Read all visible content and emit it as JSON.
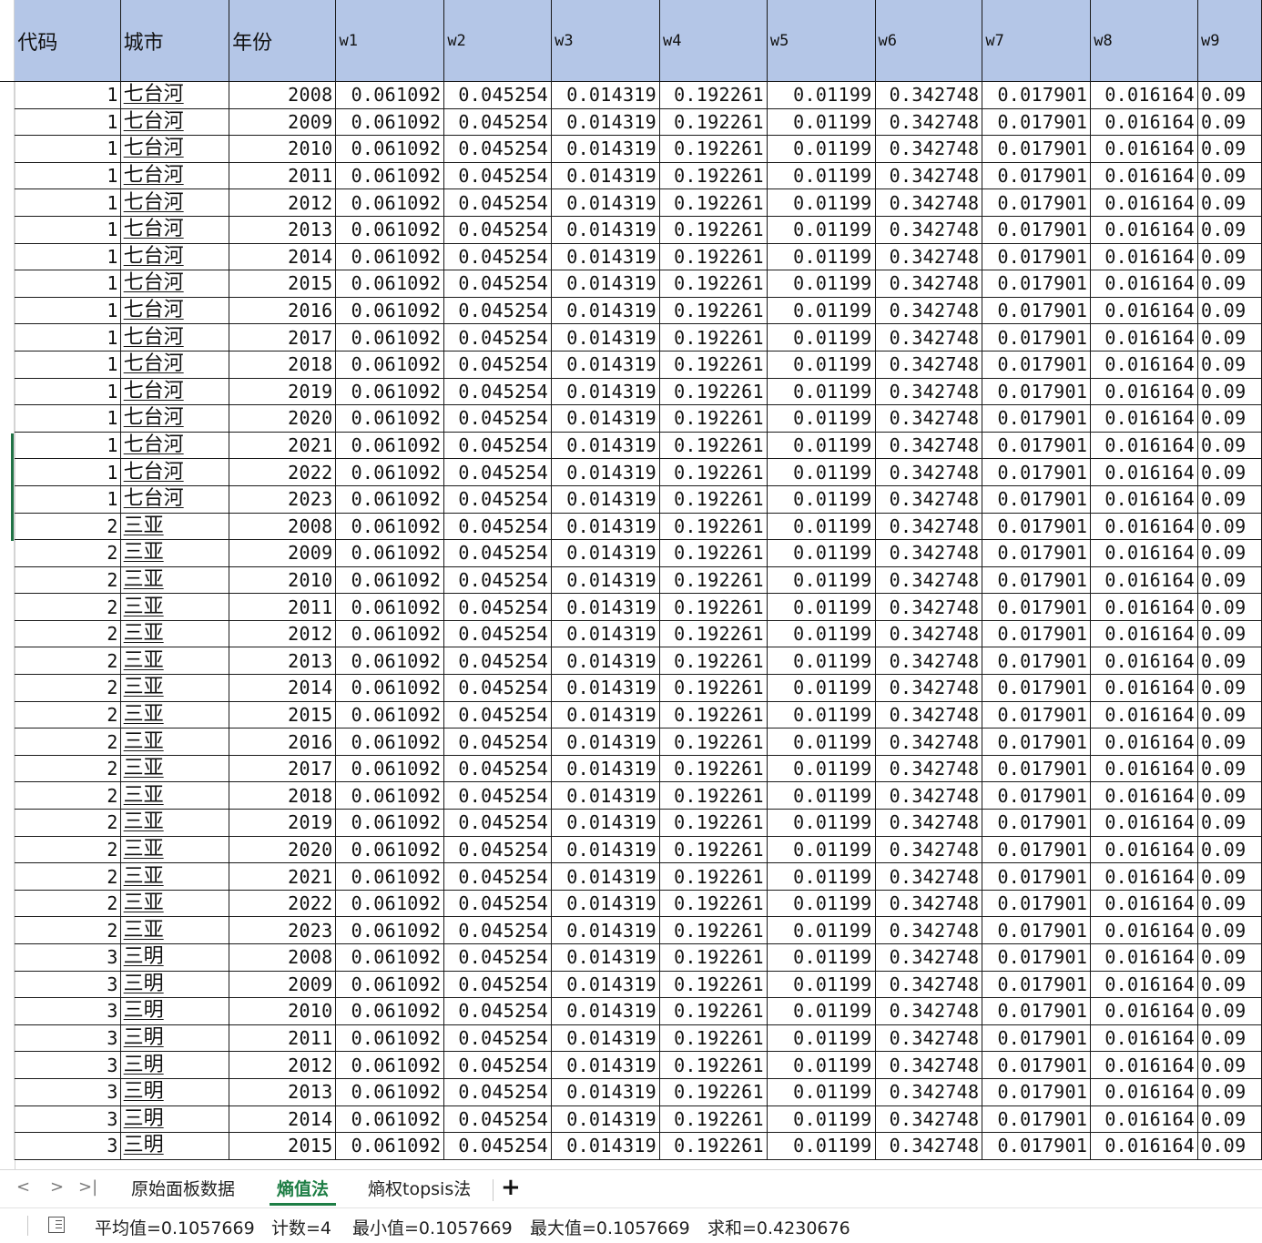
{
  "headers": [
    "代码",
    "城市",
    "年份",
    "w1",
    "w2",
    "w3",
    "w4",
    "w5",
    "w6",
    "w7",
    "w8",
    "w9"
  ],
  "weights": [
    "0.061092",
    "0.045254",
    "0.014319",
    "0.192261",
    "0.01199",
    "0.342748",
    "0.017901",
    "0.016164",
    "0.09"
  ],
  "rows": [
    {
      "code": "1",
      "city": "七台河",
      "year": "2008"
    },
    {
      "code": "1",
      "city": "七台河",
      "year": "2009"
    },
    {
      "code": "1",
      "city": "七台河",
      "year": "2010"
    },
    {
      "code": "1",
      "city": "七台河",
      "year": "2011"
    },
    {
      "code": "1",
      "city": "七台河",
      "year": "2012"
    },
    {
      "code": "1",
      "city": "七台河",
      "year": "2013"
    },
    {
      "code": "1",
      "city": "七台河",
      "year": "2014"
    },
    {
      "code": "1",
      "city": "七台河",
      "year": "2015"
    },
    {
      "code": "1",
      "city": "七台河",
      "year": "2016"
    },
    {
      "code": "1",
      "city": "七台河",
      "year": "2017"
    },
    {
      "code": "1",
      "city": "七台河",
      "year": "2018"
    },
    {
      "code": "1",
      "city": "七台河",
      "year": "2019"
    },
    {
      "code": "1",
      "city": "七台河",
      "year": "2020"
    },
    {
      "code": "1",
      "city": "七台河",
      "year": "2021"
    },
    {
      "code": "1",
      "city": "七台河",
      "year": "2022"
    },
    {
      "code": "1",
      "city": "七台河",
      "year": "2023"
    },
    {
      "code": "2",
      "city": "三亚",
      "year": "2008"
    },
    {
      "code": "2",
      "city": "三亚",
      "year": "2009"
    },
    {
      "code": "2",
      "city": "三亚",
      "year": "2010"
    },
    {
      "code": "2",
      "city": "三亚",
      "year": "2011"
    },
    {
      "code": "2",
      "city": "三亚",
      "year": "2012"
    },
    {
      "code": "2",
      "city": "三亚",
      "year": "2013"
    },
    {
      "code": "2",
      "city": "三亚",
      "year": "2014"
    },
    {
      "code": "2",
      "city": "三亚",
      "year": "2015"
    },
    {
      "code": "2",
      "city": "三亚",
      "year": "2016"
    },
    {
      "code": "2",
      "city": "三亚",
      "year": "2017"
    },
    {
      "code": "2",
      "city": "三亚",
      "year": "2018"
    },
    {
      "code": "2",
      "city": "三亚",
      "year": "2019"
    },
    {
      "code": "2",
      "city": "三亚",
      "year": "2020"
    },
    {
      "code": "2",
      "city": "三亚",
      "year": "2021"
    },
    {
      "code": "2",
      "city": "三亚",
      "year": "2022"
    },
    {
      "code": "2",
      "city": "三亚",
      "year": "2023"
    },
    {
      "code": "3",
      "city": "三明",
      "year": "2008"
    },
    {
      "code": "3",
      "city": "三明",
      "year": "2009"
    },
    {
      "code": "3",
      "city": "三明",
      "year": "2010"
    },
    {
      "code": "3",
      "city": "三明",
      "year": "2011"
    },
    {
      "code": "3",
      "city": "三明",
      "year": "2012"
    },
    {
      "code": "3",
      "city": "三明",
      "year": "2013"
    },
    {
      "code": "3",
      "city": "三明",
      "year": "2014"
    },
    {
      "code": "3",
      "city": "三明",
      "year": "2015"
    }
  ],
  "sheet_tabs": {
    "nav_prev": "<",
    "nav_next": ">",
    "nav_last": ">|",
    "tabs": [
      "原始面板数据",
      "熵值法",
      "熵权topsis法"
    ],
    "add": "+"
  },
  "status": {
    "avg": "平均值=0.1057669",
    "count": "计数=4",
    "min": "最小值=0.1057669",
    "max": "最大值=0.1057669",
    "sum": "求和=0.4230676"
  },
  "colors": {
    "header_bg": "#b4c6e7",
    "active_tab": "#1e7e45",
    "selection": "#217346"
  }
}
